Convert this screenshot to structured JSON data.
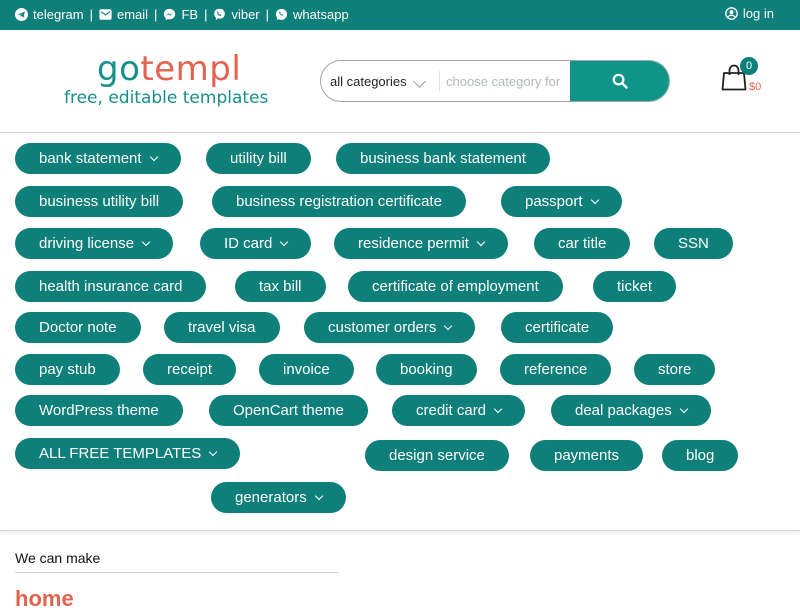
{
  "topbar": {
    "links": [
      {
        "label": "telegram",
        "icon": "telegram-icon"
      },
      {
        "label": "email",
        "icon": "email-icon"
      },
      {
        "label": "FB",
        "icon": "messenger-icon"
      },
      {
        "label": "viber",
        "icon": "viber-icon"
      },
      {
        "label": "whatsapp",
        "icon": "whatsapp-icon"
      }
    ],
    "separator": "|",
    "login": "log in"
  },
  "logo": {
    "part1": "go",
    "part2": "templ",
    "tagline": "free, editable templates"
  },
  "search": {
    "category": "all categories",
    "placeholder": "choose category for"
  },
  "cart": {
    "count": "0",
    "total": "$0"
  },
  "menu": {
    "items": [
      {
        "label": "bank statement",
        "dropdown": true
      },
      {
        "label": "utility bill",
        "dropdown": false
      },
      {
        "label": "business bank statement",
        "dropdown": false
      },
      {
        "label": "business utility bill",
        "dropdown": false
      },
      {
        "label": "business registration certificate",
        "dropdown": false
      },
      {
        "label": "passport",
        "dropdown": true
      },
      {
        "label": "driving license",
        "dropdown": true
      },
      {
        "label": "ID card",
        "dropdown": true
      },
      {
        "label": "residence permit",
        "dropdown": true
      },
      {
        "label": "car title",
        "dropdown": false
      },
      {
        "label": "SSN",
        "dropdown": false
      },
      {
        "label": "health insurance card",
        "dropdown": false
      },
      {
        "label": "tax bill",
        "dropdown": false
      },
      {
        "label": "certificate of employment",
        "dropdown": false
      },
      {
        "label": "ticket",
        "dropdown": false
      },
      {
        "label": "Doctor note",
        "dropdown": false
      },
      {
        "label": "travel visa",
        "dropdown": false
      },
      {
        "label": "customer orders",
        "dropdown": true
      },
      {
        "label": "certificate",
        "dropdown": false
      },
      {
        "label": "pay stub",
        "dropdown": false
      },
      {
        "label": "receipt",
        "dropdown": false
      },
      {
        "label": "invoice",
        "dropdown": false
      },
      {
        "label": "booking",
        "dropdown": false
      },
      {
        "label": "reference",
        "dropdown": false
      },
      {
        "label": "store",
        "dropdown": false
      },
      {
        "label": "WordPress theme",
        "dropdown": false
      },
      {
        "label": "OpenCart theme",
        "dropdown": false
      },
      {
        "label": "credit card",
        "dropdown": true
      },
      {
        "label": "deal packages",
        "dropdown": true
      },
      {
        "label": "ALL FREE TEMPLATES",
        "dropdown": true
      },
      {
        "label": "design service",
        "dropdown": false
      },
      {
        "label": "payments",
        "dropdown": false
      },
      {
        "label": "blog",
        "dropdown": false
      },
      {
        "label": "generators",
        "dropdown": true
      }
    ]
  },
  "content": {
    "note": "We can make",
    "heading": "home"
  },
  "colors": {
    "brand": "#0f7f7a",
    "accent": "#e2634f",
    "search_button": "#0f9488"
  }
}
